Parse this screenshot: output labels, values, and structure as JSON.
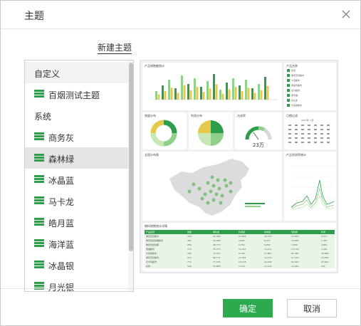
{
  "dialog": {
    "title": "主题",
    "new_theme_link": "新建主题",
    "ok_button": "确定",
    "cancel_button": "取消"
  },
  "theme_list": {
    "custom_header": "自定义",
    "custom_items": [
      "百烟测试主题"
    ],
    "system_header": "系统",
    "system_items": [
      "商务灰",
      "森林绿",
      "冰晶蓝",
      "马卡龙",
      "皓月蓝",
      "海洋蓝",
      "冰晶银",
      "月光银"
    ],
    "selected": "森林绿"
  },
  "preview": {
    "accent_color": "#2e9e4b",
    "panel_titles": {
      "bar": "产品销售额统计",
      "checklist": "产品名称",
      "pie1": "销量分布",
      "pie2": "利润分布",
      "gauge": "达成率",
      "calendar": "日期过滤",
      "map": "全国分布图",
      "line": "产品利润率统计",
      "table": "物料销售统计详情"
    },
    "gauge_value": "23万",
    "calendar_header": "2017年 八月",
    "checklist_items": [
      "百货",
      "重庆百货超市",
      "大百超市",
      "家庭乐超市",
      "麦肯超市",
      "家乐福",
      "好又多",
      "大润发超市"
    ],
    "table_headers": [
      "产品名称",
      "销量",
      "销售额",
      "利润额",
      "成本额",
      "毛利额",
      "利率"
    ],
    "table_rows": [
      [
        "重庆百货超市",
        "729",
        "92,346",
        "15,960",
        "16,775",
        "12,875",
        "6,971"
      ],
      [
        "重庆世纪新都超市",
        "382",
        "36,288",
        "4,636",
        "8,977",
        "13,835",
        "1,497"
      ],
      [
        "重庆世纪新都",
        "289",
        "28,773",
        "6,759",
        "9,834",
        "7,836",
        "4,851"
      ],
      [
        "瑞福超市",
        "279",
        "35,772",
        "12,341",
        "13,112",
        "13,770",
        "2,461"
      ],
      [
        "大润发超市",
        "706",
        "70,747",
        "9,768",
        "17,837",
        "61,381",
        "29,989"
      ],
      [
        "重庆百货超市",
        "512",
        "86,771",
        "17,344",
        "10,179",
        "27,012",
        "23,382"
      ],
      [
        "沃尔玛超市",
        "772",
        "77,478",
        "22,135",
        "22,164",
        "62,022",
        "27,621"
      ],
      [
        "好特",
        "506",
        "32,883",
        "7,130",
        "12,149",
        "12,441",
        "231"
      ]
    ]
  }
}
